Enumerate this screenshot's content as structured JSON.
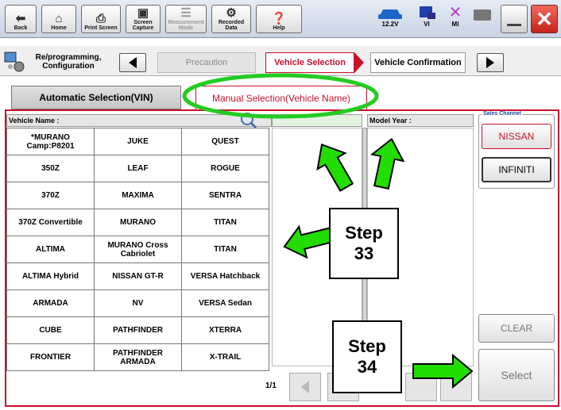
{
  "toolbar": {
    "back": "Back",
    "home": "Home",
    "print_screen": "Print Screen",
    "screen_capture": "Screen Capture",
    "measurement_mode": "Measurement Mode",
    "recorded_data": "Recorded Data",
    "help": "Help",
    "voltage": "12.2V",
    "vi": "VI",
    "mi": "MI"
  },
  "nav": {
    "section": "Re/programming, Configuration",
    "steps": [
      "Precaution",
      "Vehicle Selection",
      "Vehicle Confirmation"
    ]
  },
  "tabs": {
    "automatic": "Automatic Selection(VIN)",
    "manual": "Manual Selection(Vehicle Name)"
  },
  "table": {
    "header": "Vehicle Name :",
    "model_year_header": "Model Year :",
    "rows": [
      [
        "*MURANO Camp:P8201",
        "JUKE",
        "QUEST"
      ],
      [
        "350Z",
        "LEAF",
        "ROGUE"
      ],
      [
        "370Z",
        "MAXIMA",
        "SENTRA"
      ],
      [
        "370Z Convertible",
        "MURANO",
        "TITAN"
      ],
      [
        "ALTIMA",
        "MURANO Cross Cabriolet",
        "TITAN"
      ],
      [
        "ALTIMA Hybrid",
        "NISSAN GT-R",
        "VERSA Hatchback"
      ],
      [
        "ARMADA",
        "NV",
        "VERSA Sedan"
      ],
      [
        "CUBE",
        "PATHFINDER",
        "XTERRA"
      ],
      [
        "FRONTIER",
        "PATHFINDER ARMADA",
        "X-TRAIL"
      ]
    ],
    "page": "1/1"
  },
  "sales_channel": {
    "label": "Sales Channel",
    "options": [
      "NISSAN",
      "INFINITI"
    ]
  },
  "buttons": {
    "clear": "CLEAR",
    "select": "Select"
  },
  "annotations": {
    "step33_a": "Step",
    "step33_b": "33",
    "step34_a": "Step",
    "step34_b": "34"
  },
  "colors": {
    "accent_red": "#c8102e",
    "arrow_green": "#22dd00",
    "highlight_oval": "#22cc22"
  }
}
